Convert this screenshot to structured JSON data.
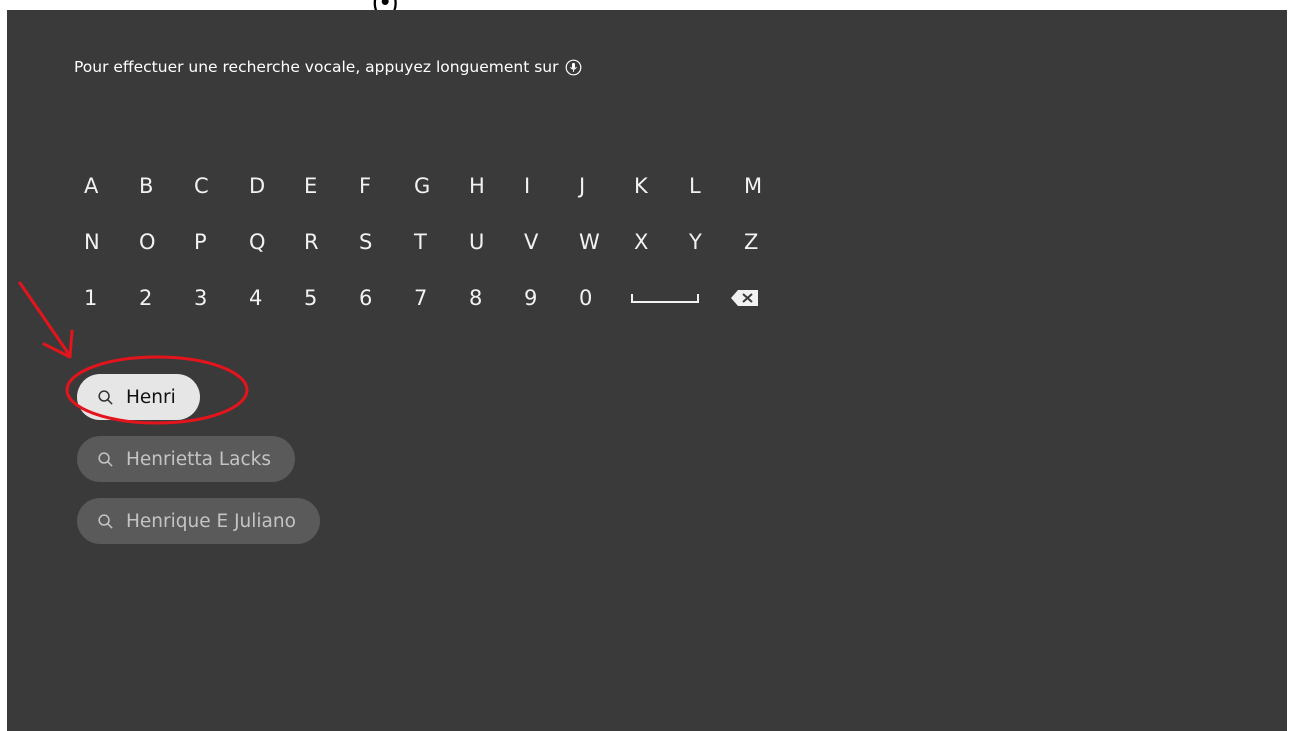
{
  "caption_fragment": "(•)",
  "voice_hint": {
    "text": "Pour effectuer une recherche vocale, appuyez longuement sur",
    "icon": "microphone-icon"
  },
  "keyboard": {
    "rows": [
      [
        "A",
        "B",
        "C",
        "D",
        "E",
        "F",
        "G",
        "H",
        "I",
        "J",
        "K",
        "L",
        "M"
      ],
      [
        "N",
        "O",
        "P",
        "Q",
        "R",
        "S",
        "T",
        "U",
        "V",
        "W",
        "X",
        "Y",
        "Z"
      ],
      [
        "1",
        "2",
        "3",
        "4",
        "5",
        "6",
        "7",
        "8",
        "9",
        "0"
      ]
    ],
    "special_keys": [
      "space-key-icon",
      "backspace-icon"
    ]
  },
  "suggestions": [
    {
      "label": "Henri",
      "focused": true,
      "icon": "search-icon"
    },
    {
      "label": "Henrietta Lacks",
      "focused": false,
      "icon": "search-icon"
    },
    {
      "label": "Henrique E Juliano",
      "focused": false,
      "icon": "search-icon"
    }
  ],
  "annotation": {
    "color": "#e3141c",
    "marks": [
      "arrow",
      "ellipse"
    ]
  },
  "colors": {
    "screen_bg": "#3a3a3a",
    "pill_bg": "#5a5a5a",
    "pill_focused_bg": "#e6e6e6",
    "key_text": "#f2f2f2"
  }
}
